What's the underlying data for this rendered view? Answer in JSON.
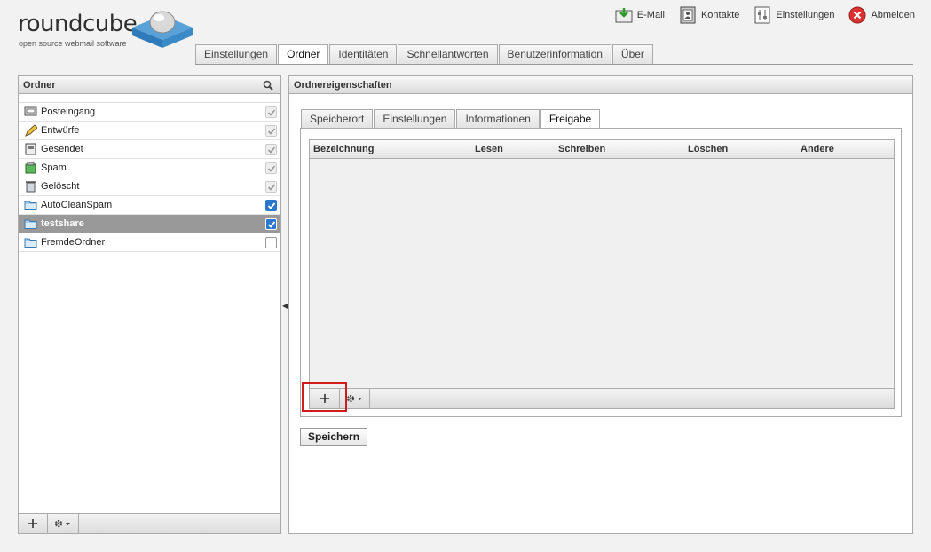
{
  "app": {
    "logo_word": "roundcube",
    "logo_tagline": "open source webmail software"
  },
  "topnav": {
    "mail": "E-Mail",
    "contacts": "Kontakte",
    "settings": "Einstellungen",
    "logout": "Abmelden"
  },
  "maintabs": [
    "Einstellungen",
    "Ordner",
    "Identitäten",
    "Schnellantworten",
    "Benutzerinformation",
    "Über"
  ],
  "maintabs_active": "Ordner",
  "folders": {
    "title": "Ordner",
    "items": [
      {
        "label": "Posteingang",
        "icon": "inbox-icon",
        "subscribed": true,
        "locked": true
      },
      {
        "label": "Entwürfe",
        "icon": "pencil-icon",
        "subscribed": true,
        "locked": true
      },
      {
        "label": "Gesendet",
        "icon": "sent-icon",
        "subscribed": true,
        "locked": true
      },
      {
        "label": "Spam",
        "icon": "spam-icon",
        "subscribed": true,
        "locked": true
      },
      {
        "label": "Gelöscht",
        "icon": "trash-icon",
        "subscribed": true,
        "locked": true
      },
      {
        "label": "AutoCleanSpam",
        "icon": "folder-icon",
        "subscribed": true,
        "locked": false
      },
      {
        "label": "testshare",
        "icon": "folder-icon",
        "subscribed": true,
        "locked": false,
        "selected": true
      },
      {
        "label": "FremdeOrdner",
        "icon": "folder-icon",
        "subscribed": false,
        "locked": false
      }
    ]
  },
  "properties": {
    "title": "Ordnereigenschaften",
    "tabs": [
      "Speicherort",
      "Einstellungen",
      "Informationen",
      "Freigabe"
    ],
    "active_tab": "Freigabe",
    "acl_columns": [
      "Bezeichnung",
      "Lesen",
      "Schreiben",
      "Löschen",
      "Andere"
    ],
    "save_label": "Speichern"
  },
  "colors": {
    "selected_row": "#999999",
    "checkbox_on": "#2b77d0",
    "highlight": "#d21b1b"
  }
}
